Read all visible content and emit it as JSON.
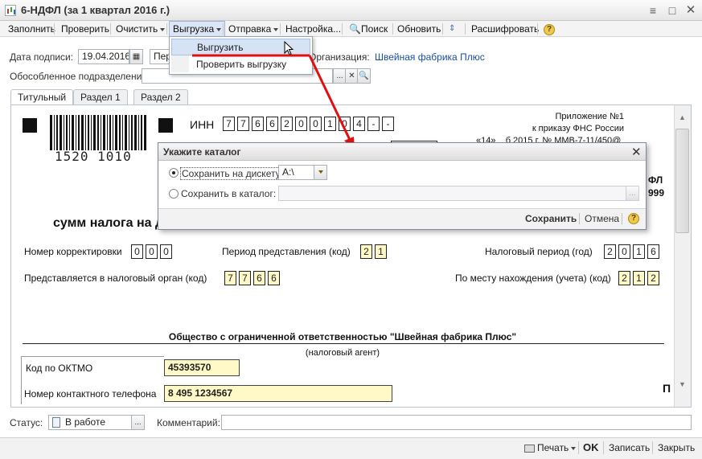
{
  "window": {
    "title": "6-НДФЛ (за 1 квартал 2016 г.)"
  },
  "toolbar": {
    "fill": "Заполнить",
    "check": "Проверить",
    "clear": "Очистить",
    "export": "Выгрузка",
    "send": "Отправка",
    "settings": "Настройка...",
    "search": "Поиск",
    "refresh": "Обновить",
    "decode": "Расшифровать",
    "help": "?"
  },
  "export_menu": {
    "items": [
      "Выгрузить",
      "Проверить выгрузку"
    ]
  },
  "form": {
    "sign_date_label": "Дата подписи:",
    "sign_date": "19.04.2016",
    "period_value": "Пер",
    "org_label": "Организация:",
    "org_value": "Швейная фабрика Плюс",
    "subdivision_label": "Обособленное подразделение:",
    "subdivision_value": ""
  },
  "tabs": [
    "Титульный",
    "Раздел 1",
    "Раздел 2"
  ],
  "doc": {
    "barcode_number": "1520 1010",
    "inn_label": "ИНН",
    "inn": [
      "7",
      "7",
      "6",
      "6",
      "2",
      "0",
      "0",
      "1",
      "0",
      "4",
      "-",
      "-"
    ],
    "appendix": [
      "Приложение №1",
      "к приказу ФНС России",
      "«14» _ б  2015 г. № ММВ-7-11/450@"
    ],
    "right_fragment_1": "ФЛ",
    "right_fragment_2": "999",
    "heading_fragment": "сумм налога на д",
    "correction_label": "Номер корректировки",
    "correction": [
      "0",
      "0",
      "0"
    ],
    "period_label": "Период представления  (код)",
    "period": [
      "2",
      "1"
    ],
    "tax_period_label": "Налоговый период (год)",
    "tax_period": [
      "2",
      "0",
      "1",
      "6"
    ],
    "tax_organ_label": "Представляется в налоговый орган   (код)",
    "tax_organ": [
      "7",
      "7",
      "6",
      "6"
    ],
    "location_label": "По месту нахождения (учета)  (код)",
    "location": [
      "2",
      "1",
      "2"
    ],
    "company_name": "Общество с ограниченной ответственностью \"Швейная фабрика Плюс\"",
    "agent_label": "(налоговый агент)",
    "oktmo_label": "Код по ОКТМО",
    "oktmo_value": "45393570",
    "phone_label": "Номер контактного телефона",
    "phone_value": "8 495 1234567",
    "p_fragment": "П"
  },
  "dialog": {
    "title": "Укажите каталог",
    "radio_diskette": "Сохранить на дискету:",
    "diskette_value": "A:\\",
    "radio_catalog": "Сохранить в каталог:",
    "catalog_value": "",
    "save": "Сохранить",
    "cancel": "Отмена",
    "help": "?"
  },
  "bottom": {
    "status_label": "Статус:",
    "status_value": "В работе",
    "comment_label": "Комментарий:",
    "comment_value": ""
  },
  "footer": {
    "print": "Печать",
    "ok": "OK",
    "save": "Записать",
    "close": "Закрыть"
  },
  "colors": {
    "accent_link": "#1b4fa2",
    "arrow": "#e01010",
    "yellow_field": "#fff9c8"
  }
}
